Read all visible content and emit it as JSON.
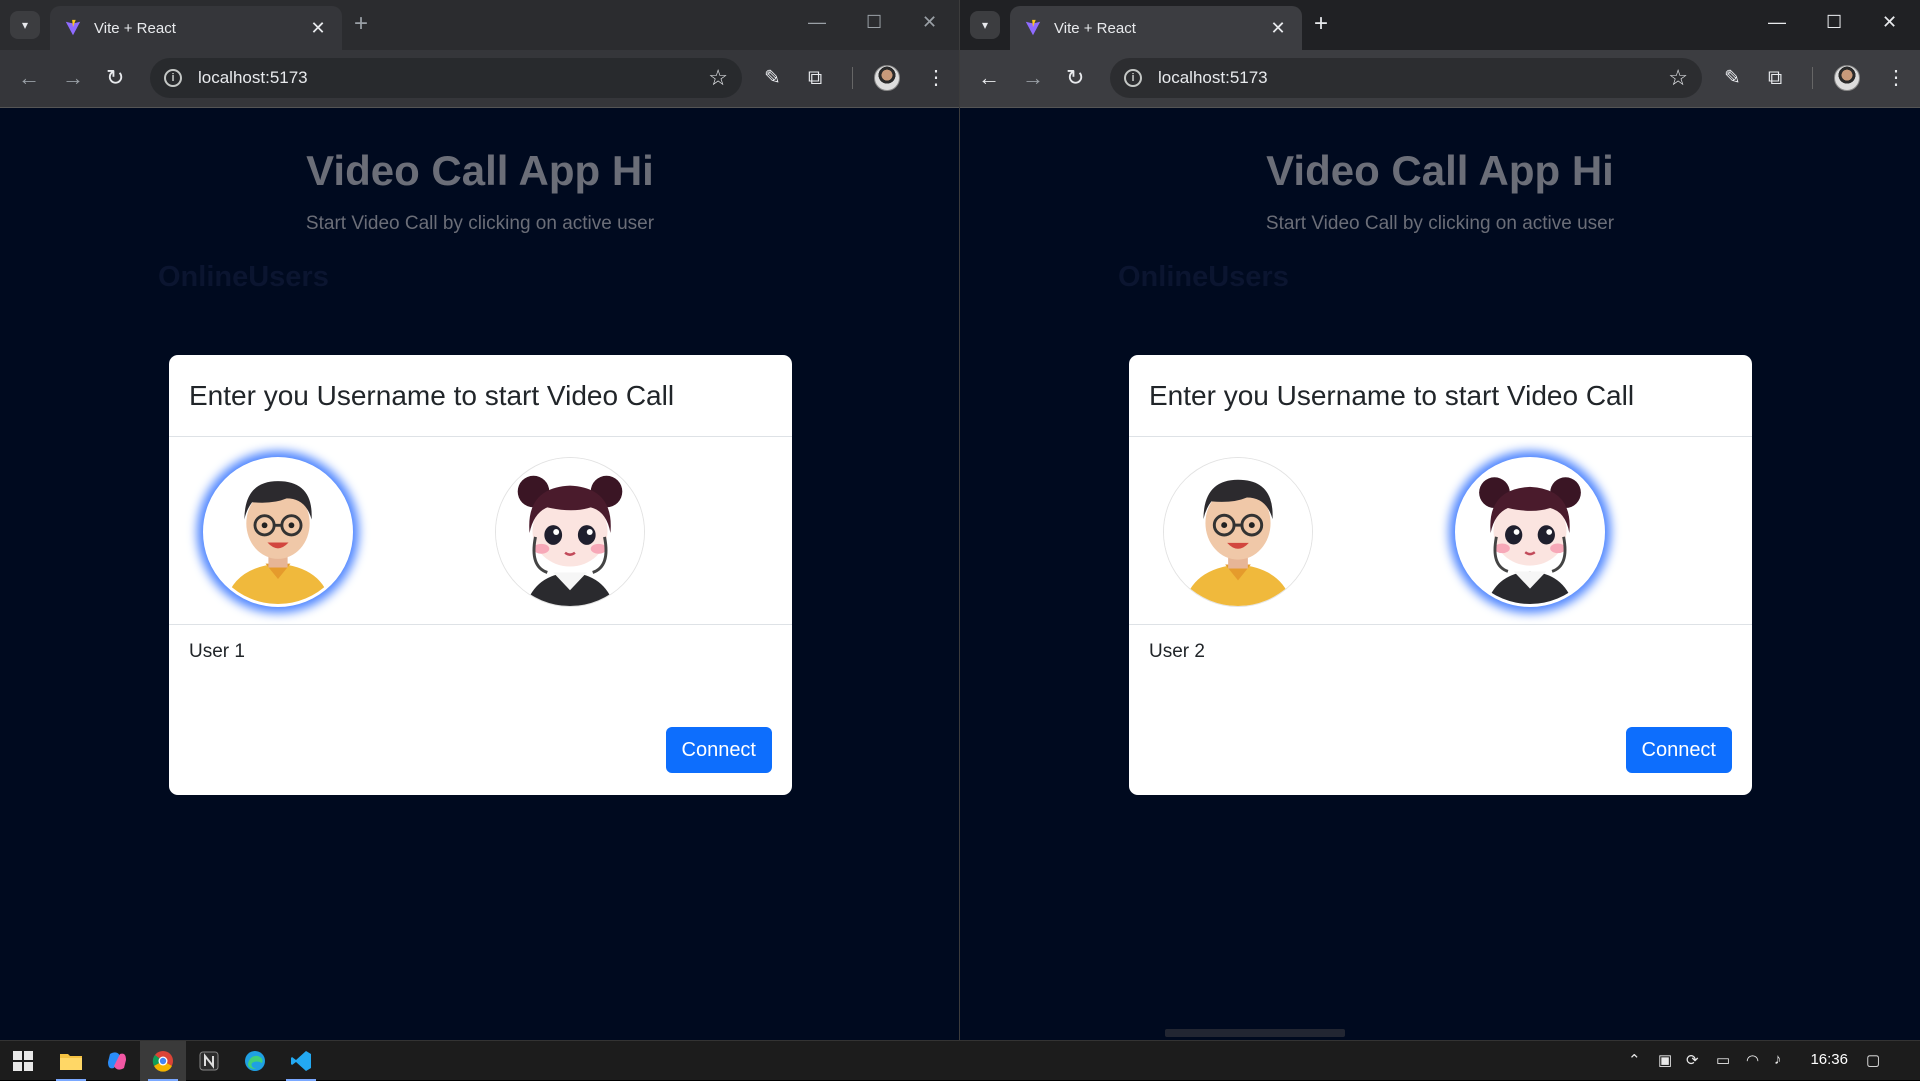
{
  "browser": {
    "tab_title": "Vite + React",
    "url": "localhost:5173"
  },
  "app": {
    "title": "Video Call App Hi",
    "subtitle": "Start Video Call by clicking on active user",
    "online_heading": "OnlineUsers"
  },
  "modal": {
    "title": "Enter you Username to start Video Call",
    "connect_label": "Connect"
  },
  "windows": [
    {
      "selected_user": "User 1",
      "selected_avatar": 1
    },
    {
      "selected_user": "User 2",
      "selected_avatar": 2
    }
  ],
  "taskbar": {
    "time": "16:36"
  },
  "colors": {
    "page_bg": "#000a1f",
    "accent": "#0d6efd",
    "selection_glow": "#4f86ff"
  }
}
